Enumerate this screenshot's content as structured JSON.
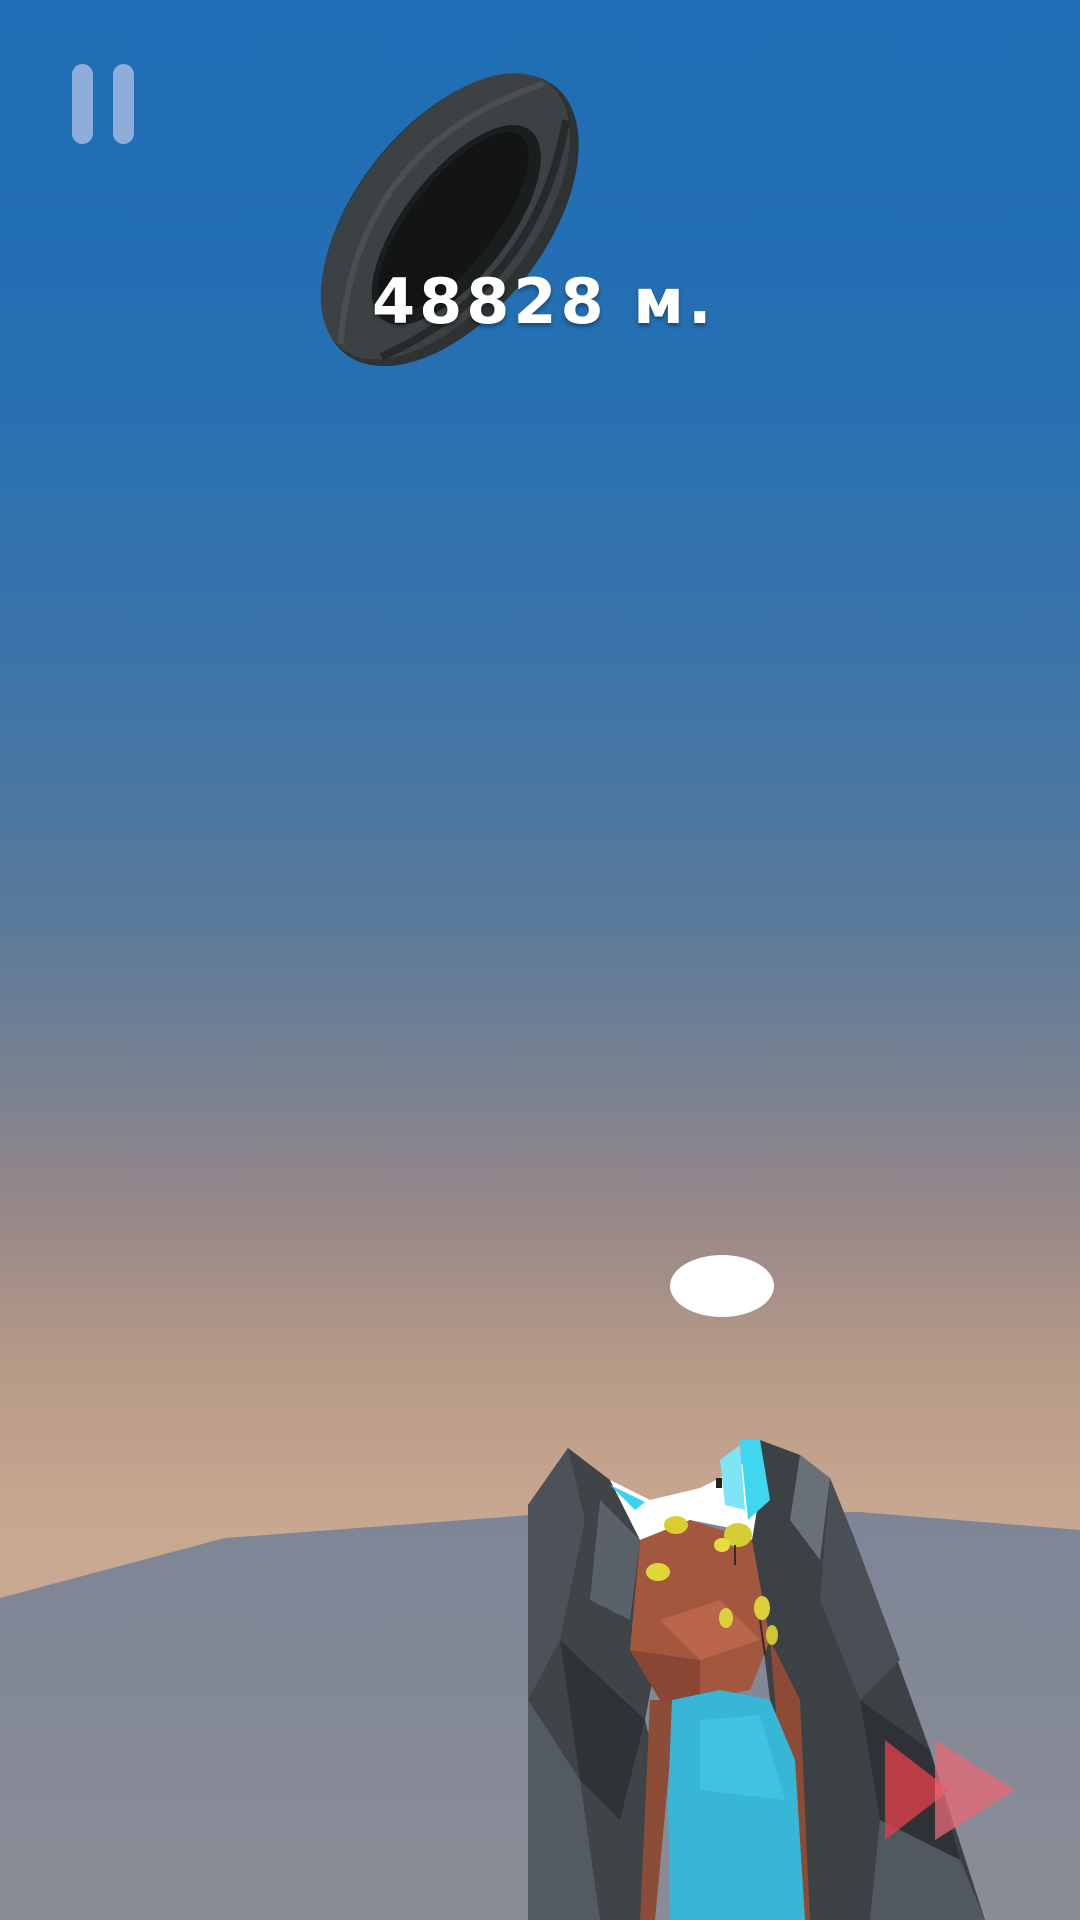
{
  "hud": {
    "distance": "48828 м."
  },
  "icons": {
    "pause": "pause-icon",
    "skip": "fast-forward-icon",
    "tire": "tire-icon"
  },
  "colors": {
    "sky_top": "#1f6db5",
    "sky_horizon": "#c9a890",
    "ground": "#7a8294",
    "skip_button": "#e0454f",
    "pause_button": "#b4c3e6"
  }
}
